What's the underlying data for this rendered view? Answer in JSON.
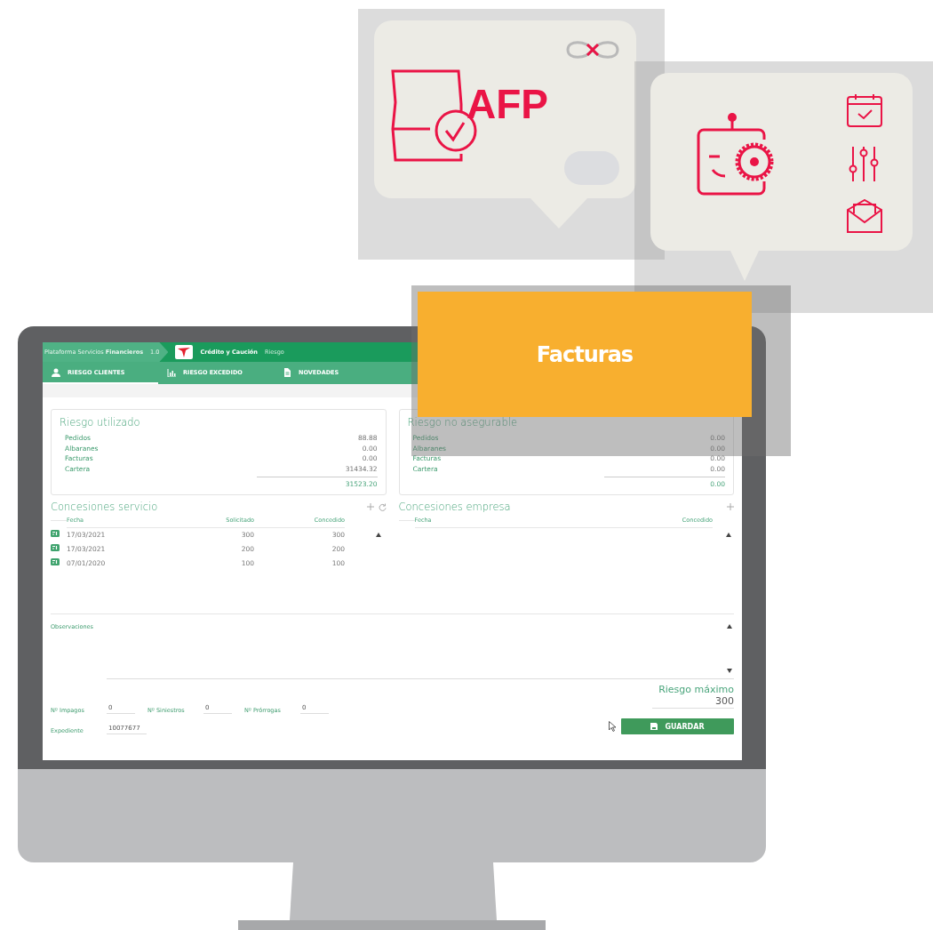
{
  "afp_bubble": {
    "logo_text": "AFP"
  },
  "highlight_card": {
    "label": "Facturas"
  },
  "app": {
    "breadcrumb": {
      "platform": "Plataforma Servicios **Financieros**",
      "version": "1.0",
      "module": "Crédito y Caución",
      "section": "Riesgo"
    },
    "tabs": [
      {
        "label": "RIESGO CLIENTES",
        "selected": true
      },
      {
        "label": "RIESGO EXCEDIDO",
        "selected": false
      },
      {
        "label": "NOVEDADES",
        "selected": false
      }
    ],
    "summaries": [
      {
        "title": "Riesgo utilizado",
        "rows": [
          {
            "label": "Pedidos",
            "value": "88.88"
          },
          {
            "label": "Albaranes",
            "value": "0.00"
          },
          {
            "label": "Facturas",
            "value": "0.00"
          },
          {
            "label": "Cartera",
            "value": "31434.32"
          }
        ],
        "total": "31523.20"
      },
      {
        "title": "Riesgo no asegurable",
        "rows": [
          {
            "label": "Pedidos",
            "value": "0.00"
          },
          {
            "label": "Albaranes",
            "value": "0.00"
          },
          {
            "label": "Facturas",
            "value": "0.00"
          },
          {
            "label": "Cartera",
            "value": "0.00"
          }
        ],
        "total": "0.00"
      }
    ],
    "concesiones_servicio": {
      "title": "Concesiones servicio",
      "columns": [
        "Fecha",
        "Solicitado",
        "Concedido"
      ],
      "rows": [
        {
          "fecha": "17/03/2021",
          "solicitado": "300",
          "concedido": "300"
        },
        {
          "fecha": "17/03/2021",
          "solicitado": "200",
          "concedido": "200"
        },
        {
          "fecha": "07/01/2020",
          "solicitado": "100",
          "concedido": "100"
        }
      ]
    },
    "concesiones_empresa": {
      "title": "Concesiones empresa",
      "columns": [
        "Fecha",
        "Concedido"
      ]
    },
    "observaciones": {
      "label": "Observaciones"
    },
    "counters": [
      {
        "label": "Nº Impagos",
        "value": "0"
      },
      {
        "label": "Nº Siniestros",
        "value": "0"
      },
      {
        "label": "Nº Prórrogas",
        "value": "0"
      }
    ],
    "expediente": {
      "label": "Expediente",
      "value": "10077677"
    },
    "riesgo_maximo": {
      "label": "Riesgo máximo",
      "value": "300"
    },
    "save_button": {
      "label": "GUARDAR"
    }
  }
}
